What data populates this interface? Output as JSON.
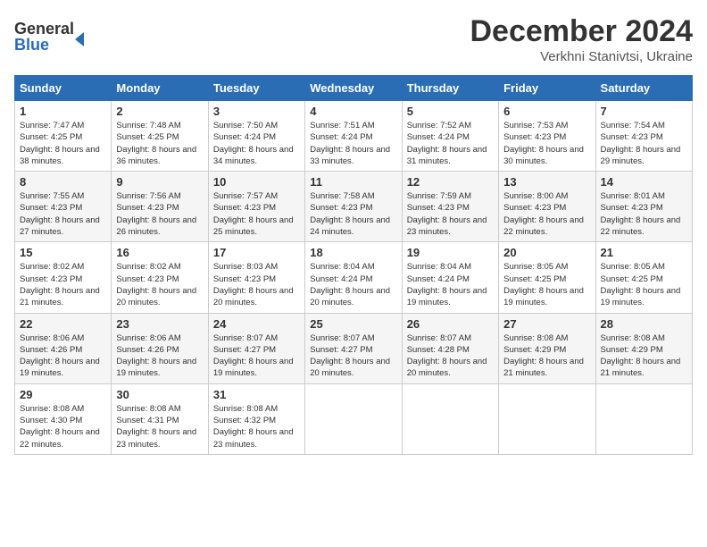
{
  "header": {
    "logo_line1": "General",
    "logo_line2": "Blue",
    "month": "December 2024",
    "location": "Verkhni Stanivtsi, Ukraine"
  },
  "days_of_week": [
    "Sunday",
    "Monday",
    "Tuesday",
    "Wednesday",
    "Thursday",
    "Friday",
    "Saturday"
  ],
  "weeks": [
    [
      {
        "day": "1",
        "sunrise": "7:47 AM",
        "sunset": "4:25 PM",
        "daylight": "8 hours and 38 minutes."
      },
      {
        "day": "2",
        "sunrise": "7:48 AM",
        "sunset": "4:25 PM",
        "daylight": "8 hours and 36 minutes."
      },
      {
        "day": "3",
        "sunrise": "7:50 AM",
        "sunset": "4:24 PM",
        "daylight": "8 hours and 34 minutes."
      },
      {
        "day": "4",
        "sunrise": "7:51 AM",
        "sunset": "4:24 PM",
        "daylight": "8 hours and 33 minutes."
      },
      {
        "day": "5",
        "sunrise": "7:52 AM",
        "sunset": "4:24 PM",
        "daylight": "8 hours and 31 minutes."
      },
      {
        "day": "6",
        "sunrise": "7:53 AM",
        "sunset": "4:23 PM",
        "daylight": "8 hours and 30 minutes."
      },
      {
        "day": "7",
        "sunrise": "7:54 AM",
        "sunset": "4:23 PM",
        "daylight": "8 hours and 29 minutes."
      }
    ],
    [
      {
        "day": "8",
        "sunrise": "7:55 AM",
        "sunset": "4:23 PM",
        "daylight": "8 hours and 27 minutes."
      },
      {
        "day": "9",
        "sunrise": "7:56 AM",
        "sunset": "4:23 PM",
        "daylight": "8 hours and 26 minutes."
      },
      {
        "day": "10",
        "sunrise": "7:57 AM",
        "sunset": "4:23 PM",
        "daylight": "8 hours and 25 minutes."
      },
      {
        "day": "11",
        "sunrise": "7:58 AM",
        "sunset": "4:23 PM",
        "daylight": "8 hours and 24 minutes."
      },
      {
        "day": "12",
        "sunrise": "7:59 AM",
        "sunset": "4:23 PM",
        "daylight": "8 hours and 23 minutes."
      },
      {
        "day": "13",
        "sunrise": "8:00 AM",
        "sunset": "4:23 PM",
        "daylight": "8 hours and 22 minutes."
      },
      {
        "day": "14",
        "sunrise": "8:01 AM",
        "sunset": "4:23 PM",
        "daylight": "8 hours and 22 minutes."
      }
    ],
    [
      {
        "day": "15",
        "sunrise": "8:02 AM",
        "sunset": "4:23 PM",
        "daylight": "8 hours and 21 minutes."
      },
      {
        "day": "16",
        "sunrise": "8:02 AM",
        "sunset": "4:23 PM",
        "daylight": "8 hours and 20 minutes."
      },
      {
        "day": "17",
        "sunrise": "8:03 AM",
        "sunset": "4:23 PM",
        "daylight": "8 hours and 20 minutes."
      },
      {
        "day": "18",
        "sunrise": "8:04 AM",
        "sunset": "4:24 PM",
        "daylight": "8 hours and 20 minutes."
      },
      {
        "day": "19",
        "sunrise": "8:04 AM",
        "sunset": "4:24 PM",
        "daylight": "8 hours and 19 minutes."
      },
      {
        "day": "20",
        "sunrise": "8:05 AM",
        "sunset": "4:25 PM",
        "daylight": "8 hours and 19 minutes."
      },
      {
        "day": "21",
        "sunrise": "8:05 AM",
        "sunset": "4:25 PM",
        "daylight": "8 hours and 19 minutes."
      }
    ],
    [
      {
        "day": "22",
        "sunrise": "8:06 AM",
        "sunset": "4:26 PM",
        "daylight": "8 hours and 19 minutes."
      },
      {
        "day": "23",
        "sunrise": "8:06 AM",
        "sunset": "4:26 PM",
        "daylight": "8 hours and 19 minutes."
      },
      {
        "day": "24",
        "sunrise": "8:07 AM",
        "sunset": "4:27 PM",
        "daylight": "8 hours and 19 minutes."
      },
      {
        "day": "25",
        "sunrise": "8:07 AM",
        "sunset": "4:27 PM",
        "daylight": "8 hours and 20 minutes."
      },
      {
        "day": "26",
        "sunrise": "8:07 AM",
        "sunset": "4:28 PM",
        "daylight": "8 hours and 20 minutes."
      },
      {
        "day": "27",
        "sunrise": "8:08 AM",
        "sunset": "4:29 PM",
        "daylight": "8 hours and 21 minutes."
      },
      {
        "day": "28",
        "sunrise": "8:08 AM",
        "sunset": "4:29 PM",
        "daylight": "8 hours and 21 minutes."
      }
    ],
    [
      {
        "day": "29",
        "sunrise": "8:08 AM",
        "sunset": "4:30 PM",
        "daylight": "8 hours and 22 minutes."
      },
      {
        "day": "30",
        "sunrise": "8:08 AM",
        "sunset": "4:31 PM",
        "daylight": "8 hours and 23 minutes."
      },
      {
        "day": "31",
        "sunrise": "8:08 AM",
        "sunset": "4:32 PM",
        "daylight": "8 hours and 23 minutes."
      },
      null,
      null,
      null,
      null
    ]
  ]
}
